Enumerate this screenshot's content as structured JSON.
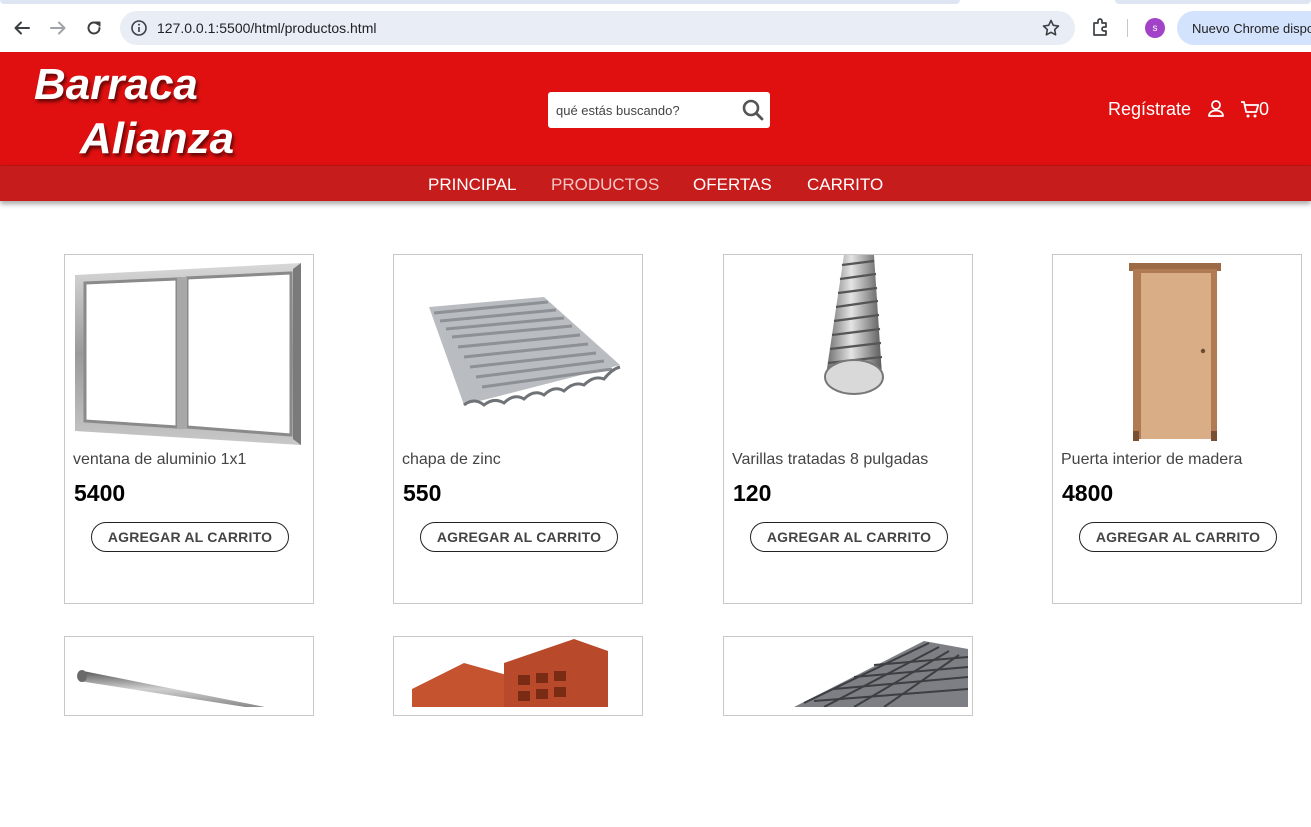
{
  "browser": {
    "url": "127.0.0.1:5500/html/productos.html",
    "profile_initial": "s",
    "update_label": "Nuevo Chrome disponible"
  },
  "header": {
    "logo_line1": "Barraca",
    "logo_line2": "Alianza",
    "search_placeholder": "qué estás buscando?",
    "register_label": "Regístrate",
    "cart_count": "0",
    "brand_color": "#e01010",
    "nav_color": "#c71c1c"
  },
  "nav": {
    "items": [
      {
        "label": "PRINCIPAL"
      },
      {
        "label": "PRODUCTOS",
        "active": true
      },
      {
        "label": "OFERTAS"
      },
      {
        "label": "CARRITO"
      }
    ]
  },
  "products": [
    {
      "name": "ventana de aluminio 1x1",
      "price": "5400",
      "button": "AGREGAR AL CARRITO",
      "image": "aluminium-window"
    },
    {
      "name": "chapa de zinc",
      "price": "550",
      "button": "AGREGAR AL CARRITO",
      "image": "corrugated-zinc-sheet"
    },
    {
      "name": "Varillas tratadas 8 pulgadas",
      "price": "120",
      "button": "AGREGAR AL CARRITO",
      "image": "rebar-rod"
    },
    {
      "name": "Puerta interior de madera",
      "price": "4800",
      "button": "AGREGAR AL CARRITO",
      "image": "wooden-door"
    },
    {
      "image": "metal-pipe"
    },
    {
      "image": "clay-bricks"
    },
    {
      "image": "wire-mesh-roll"
    }
  ]
}
